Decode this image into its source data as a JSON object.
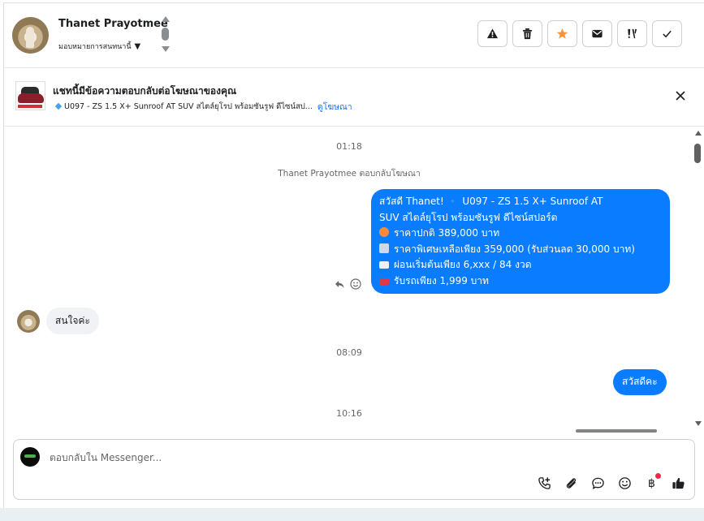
{
  "header": {
    "contact_name": "Thanet Prayotmee",
    "assign_label": "มอบหมายการสนทนานี้",
    "actions": [
      {
        "name": "report-button",
        "icon": "warning-icon"
      },
      {
        "name": "delete-button",
        "icon": "trash-icon"
      },
      {
        "name": "star-button",
        "icon": "star-icon"
      },
      {
        "name": "mark-unread-button",
        "icon": "envelope-icon"
      },
      {
        "name": "spam-button",
        "icon": "exclamation-icon"
      },
      {
        "name": "done-button",
        "icon": "check-icon"
      }
    ],
    "star_color": "#f7923a"
  },
  "ad": {
    "title": "แชทนี้มีข้อความตอบกลับต่อโฆษณาของคุณ",
    "summary": "U097 - ZS 1.5 X+ Sunroof AT SUV สไตล์ยุโรป พร้อมซันรูฟ ดีไซน์สป...",
    "link": "ดูโฆษณา"
  },
  "chat": {
    "time1": "01:18",
    "system_note": "Thanet Prayotmee ตอบกลับโฆษณา",
    "outgoing_ad_reply": [
      "สวัสดี Thanet! 🔹 U097 - ZS 1.5 X+ Sunroof AT",
      "SUV สไตล์ยุโรป พร้อมซันรูฟ ดีไซน์สปอร์ต",
      "ราคาปกติ 389,000 บาท",
      "ราคาพิเศษเหลือเพียง 359,000 (รับส่วนลด 30,000 บาท)",
      "ผ่อนเริ่มต้นเพียง 6,xxx / 84 งวด",
      "รับรถเพียง 1,999 บาท"
    ],
    "incoming_message": "สนใจค่ะ",
    "time2": "08:09",
    "outgoing_greeting": "สวัสดีคะ",
    "time3": "10:16"
  },
  "composer": {
    "placeholder": "ตอบกลับใน Messenger...",
    "tools": [
      "call-add-icon",
      "attachment-icon",
      "saved-reply-icon",
      "emoji-icon",
      "baht-icon",
      "like-icon"
    ]
  },
  "colors": {
    "accent": "#0a7cff",
    "link": "#1b74e4",
    "badge": "#f02849"
  }
}
